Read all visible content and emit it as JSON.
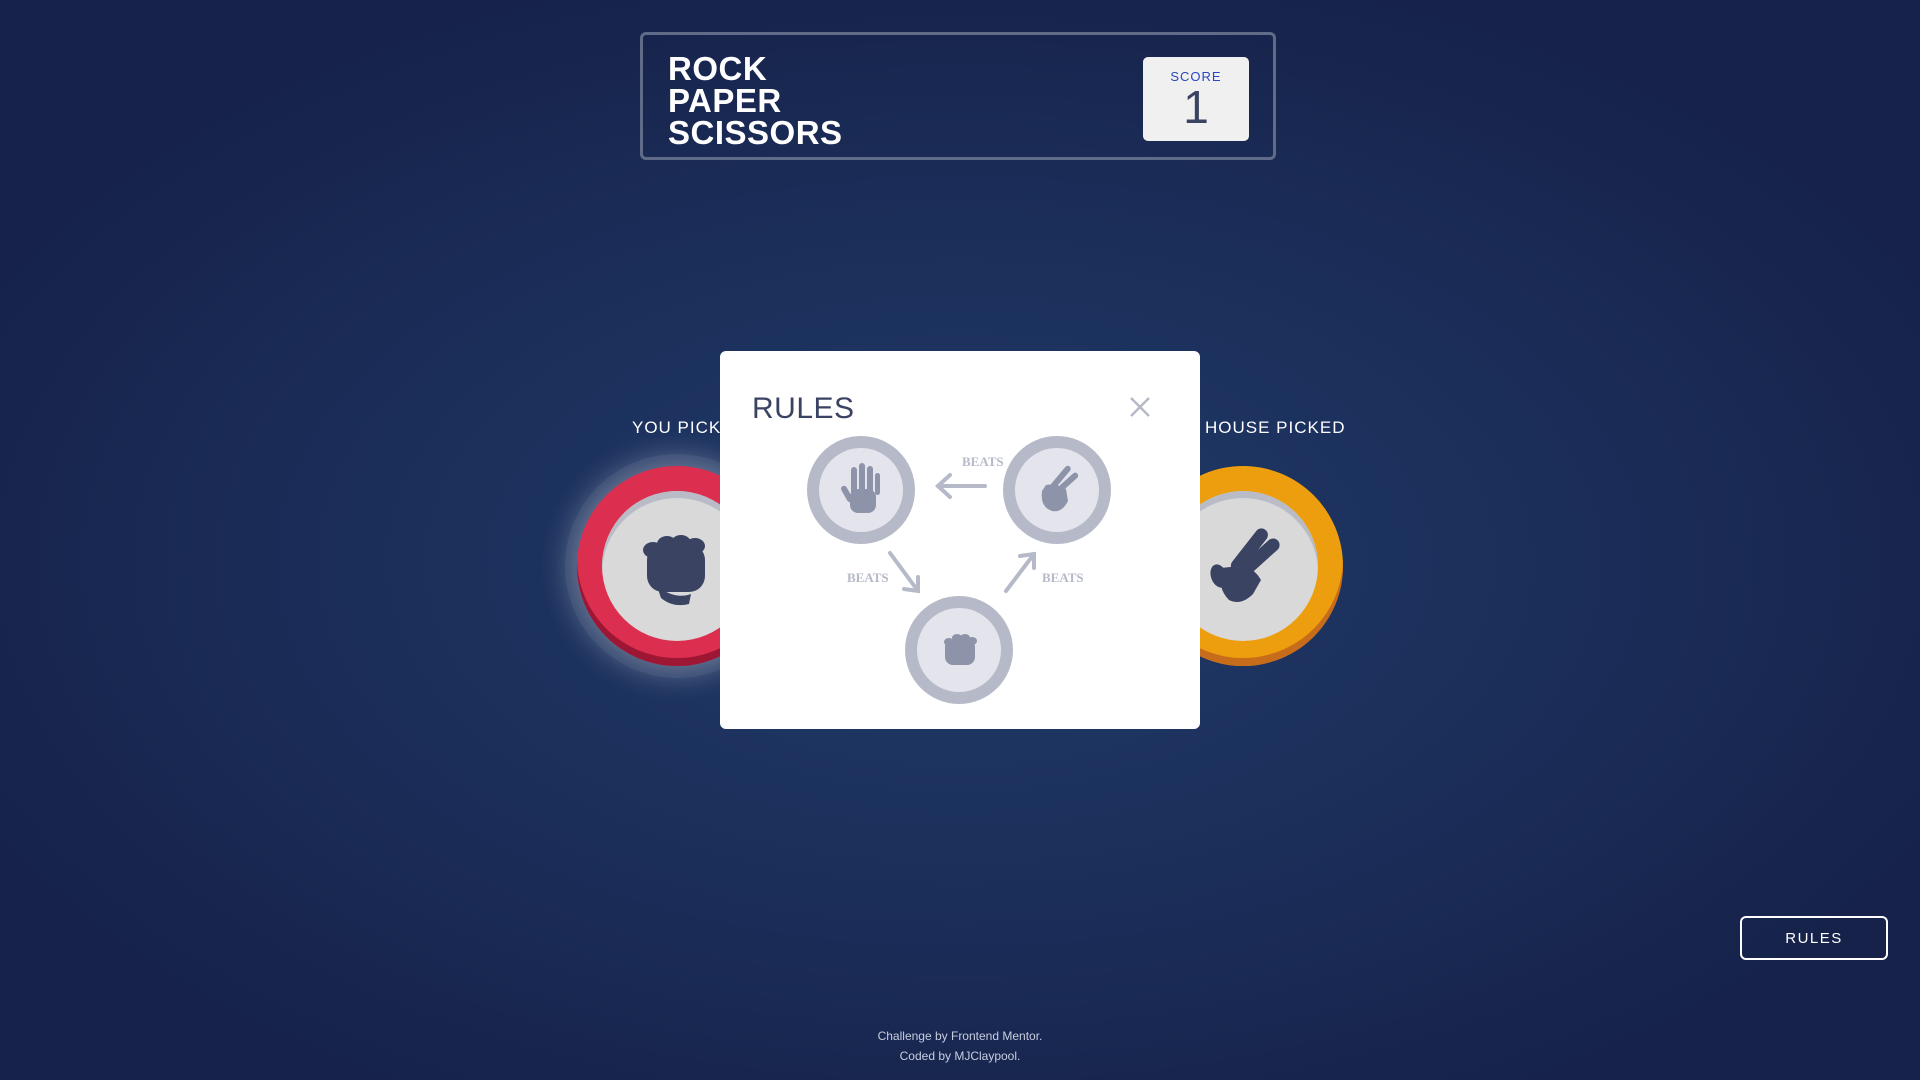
{
  "header": {
    "logo_lines": [
      "ROCK",
      "PAPER",
      "SCISSORS"
    ],
    "score_label": "SCORE",
    "score_value": "1"
  },
  "game": {
    "player_label": "YOU PICKED",
    "house_label": "HOUSE PICKED",
    "player_pick": "rock",
    "house_pick": "scissors"
  },
  "rules_modal": {
    "title": "RULES",
    "beats_label": "BEATS",
    "relations": [
      {
        "winner": "scissors",
        "loser": "paper"
      },
      {
        "winner": "paper",
        "loser": "rock"
      },
      {
        "winner": "rock",
        "loser": "scissors"
      }
    ]
  },
  "rules_button_label": "RULES",
  "footer": {
    "line1_prefix": "Challenge by ",
    "line1_link": "Frontend Mentor",
    "line1_suffix": ".",
    "line2_prefix": "Coded by ",
    "line2_link": "MJClaypool",
    "line2_suffix": "."
  },
  "colors": {
    "background": "#1f3756",
    "rock_ring": "#dc2e4e",
    "scissors_ring": "#ec9e0e",
    "paper_ring": "#4865f4",
    "score_text": "#2a46c0",
    "dark_text": "#3b4363",
    "diagram_gray": "#b6b9c8"
  },
  "icons": {
    "rock": "fist-icon",
    "paper": "open-hand-icon",
    "scissors": "peace-hand-icon",
    "close": "close-icon",
    "arrow": "arrow-icon"
  }
}
